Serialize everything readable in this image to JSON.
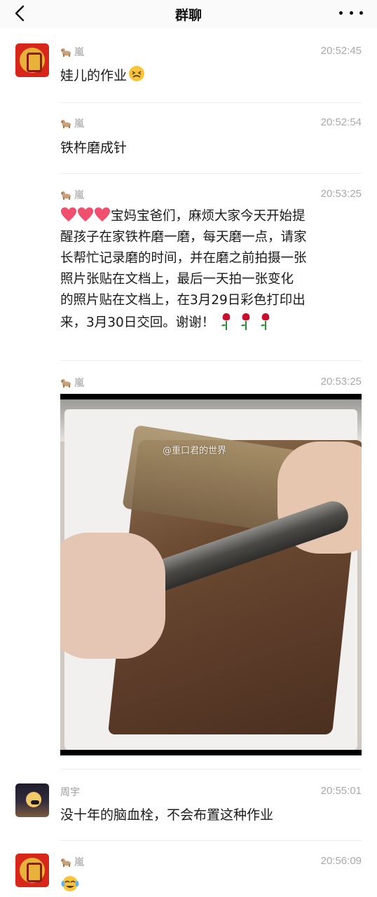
{
  "header": {
    "title": "群聊",
    "back_icon": "chevron-left-icon",
    "more_icon": "more-dots-icon"
  },
  "messages": [
    {
      "sender": "嵐",
      "time": "20:52:45",
      "text": "娃儿的作业",
      "trailing_emoji": "persevering-face-emoji"
    },
    {
      "sender": "嵐",
      "time": "20:52:54",
      "text": "铁杵磨成针"
    },
    {
      "sender": "嵐",
      "time": "20:53:25",
      "lead_emoji": "heart-emoji x3",
      "lines": [
        "宝妈宝爸们，麻烦大家今天开始提",
        "醒孩子在家铁杵磨一磨，每天磨一点，请家",
        "长帮忙记录磨的时间，并在磨之前拍摄一张",
        "照片张贴在文档上，最后一天拍一张变化",
        "的照片贴在文档上，在3月29日彩色打印出",
        "来，3月30日交回。谢谢！"
      ],
      "trailing_emoji": "rose-emoji x3"
    },
    {
      "sender": "嵐",
      "time": "20:53:25",
      "image": "photo of hands rubbing a steel pipe on a stone brick",
      "watermark": "@重口君的世界"
    },
    {
      "sender": "周宇",
      "time": "20:55:01",
      "text": "没十年的脑血栓，不会布置这种作业"
    },
    {
      "sender": "嵐",
      "time": "20:56:09",
      "trailing_emoji": "crying-laughing-emoji"
    }
  ],
  "colors": {
    "avatar_red": "#d7261a",
    "timestamp": "#a8a8a8",
    "heart": "#f0506e",
    "rose": "#c8102e"
  }
}
